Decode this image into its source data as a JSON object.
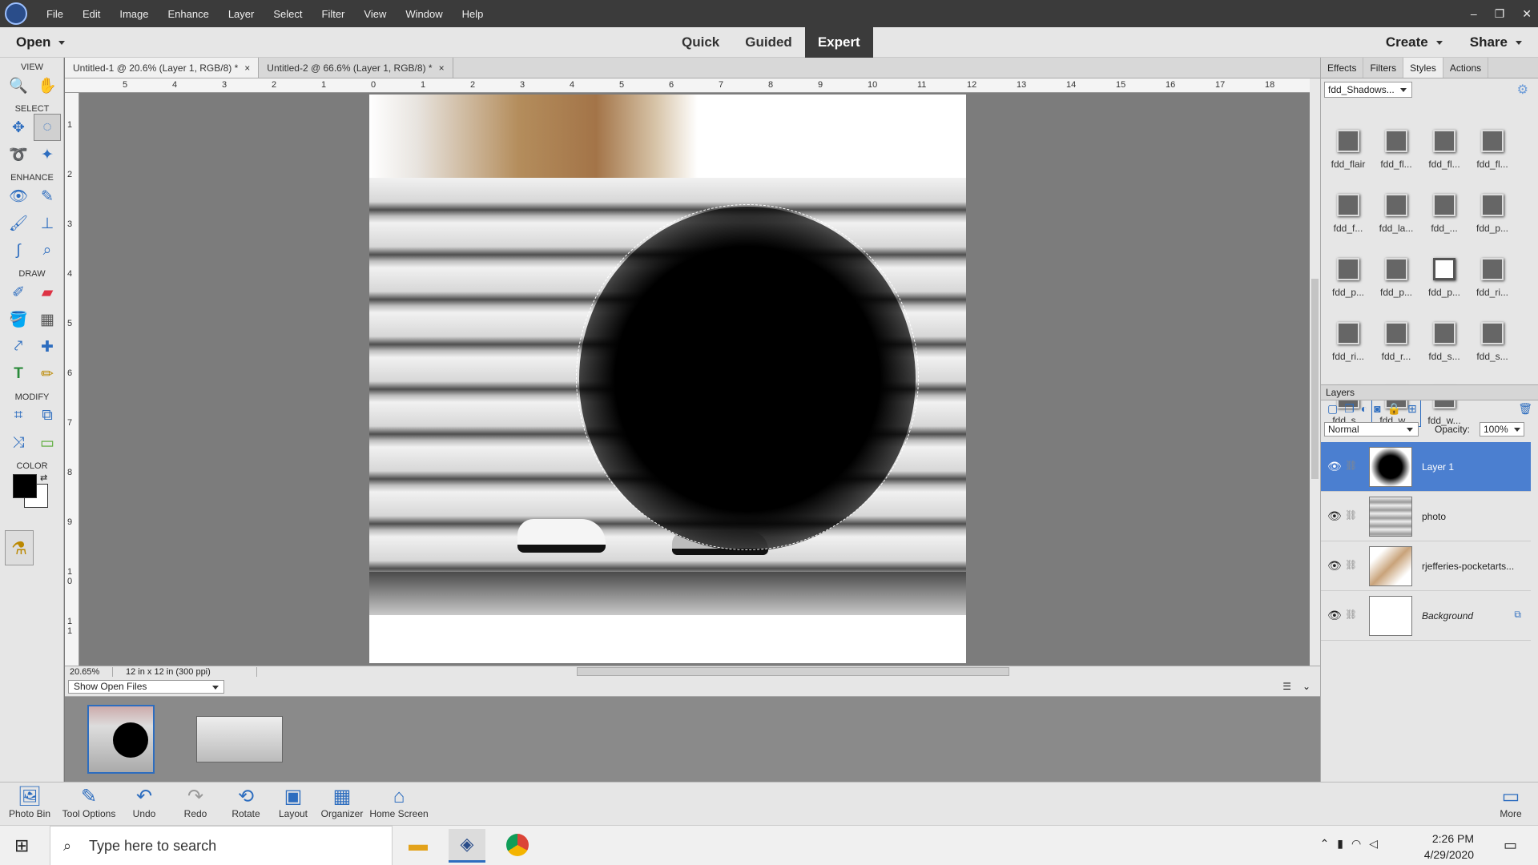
{
  "menubar": {
    "items": [
      "File",
      "Edit",
      "Image",
      "Enhance",
      "Layer",
      "Select",
      "Filter",
      "View",
      "Window",
      "Help"
    ]
  },
  "window_controls": {
    "minimize": "–",
    "restore": "❐",
    "close": "✕"
  },
  "modebar": {
    "open_label": "Open",
    "modes": [
      "Quick",
      "Guided",
      "Expert"
    ],
    "active_mode": "Expert",
    "create_label": "Create",
    "share_label": "Share"
  },
  "toolbox": {
    "sections": [
      "VIEW",
      "SELECT",
      "ENHANCE",
      "DRAW",
      "MODIFY",
      "COLOR"
    ],
    "foreground_color": "#000000",
    "background_color": "#ffffff"
  },
  "doc_tabs": [
    {
      "label": "Untitled-1 @ 20.6% (Layer 1, RGB/8) *",
      "active": true
    },
    {
      "label": "Untitled-2 @ 66.6% (Layer 1, RGB/8) *",
      "active": false
    }
  ],
  "ruler": {
    "top_ticks": [
      "5",
      "4",
      "3",
      "2",
      "1",
      "0",
      "1",
      "2",
      "3",
      "4",
      "5",
      "6",
      "7",
      "8",
      "9",
      "10",
      "11",
      "12",
      "13",
      "14",
      "15",
      "16",
      "17",
      "18"
    ],
    "left_ticks": [
      "1",
      "2",
      "3",
      "4",
      "5",
      "6",
      "7",
      "8",
      "9",
      "1 0",
      "1 1"
    ]
  },
  "status": {
    "zoom": "20.65%",
    "dimensions": "12 in x 12 in (300 ppi)"
  },
  "photo_bin": {
    "show_label": "Show Open Files"
  },
  "bottom_toolbar": {
    "photo_bin": "Photo Bin",
    "tool_options": "Tool Options",
    "undo": "Undo",
    "redo": "Redo",
    "rotate": "Rotate",
    "layout": "Layout",
    "organizer": "Organizer",
    "home_screen": "Home Screen",
    "more": "More"
  },
  "panel": {
    "tabs": [
      "Effects",
      "Filters",
      "Styles",
      "Actions"
    ],
    "active_tab": "Styles",
    "style_library": "fdd_Shadows...",
    "styles": [
      "fdd_flair",
      "fdd_fl...",
      "fdd_fl...",
      "fdd_fl...",
      "fdd_f...",
      "fdd_la...",
      "fdd_...",
      "fdd_p...",
      "fdd_p...",
      "fdd_p...",
      "fdd_p...",
      "fdd_ri...",
      "fdd_ri...",
      "fdd_r...",
      "fdd_s...",
      "fdd_s...",
      "fdd_s...",
      "fdd_w...",
      "fdd_w..."
    ]
  },
  "layers": {
    "title": "Layers",
    "blend_mode": "Normal",
    "opacity_label": "Opacity:",
    "opacity_value": "100%",
    "items": [
      {
        "name": "Layer 1",
        "selected": true
      },
      {
        "name": "photo",
        "selected": false
      },
      {
        "name": "rjefferies-pocketarts...",
        "selected": false
      },
      {
        "name": "Background",
        "selected": false
      }
    ]
  },
  "taskbar": {
    "search_placeholder": "Type here to search",
    "time": "2:26 PM",
    "date": "4/29/2020"
  }
}
